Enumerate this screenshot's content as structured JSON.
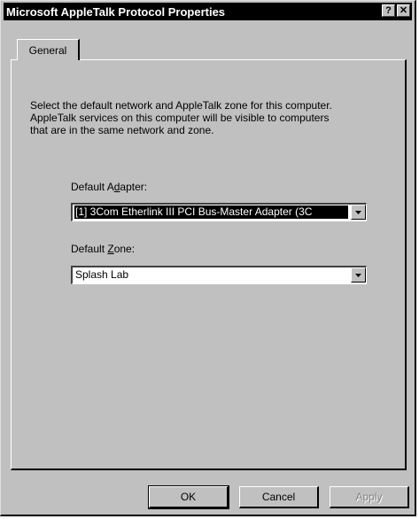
{
  "window": {
    "title": "Microsoft AppleTalk Protocol Properties",
    "help_glyph": "?",
    "close_glyph": "✕"
  },
  "tabs": [
    {
      "label": "General"
    }
  ],
  "description": {
    "line1": "Select the default network and AppleTalk zone for this computer.",
    "line2": "AppleTalk services on this computer will be visible to computers",
    "line3": "that are in the same network and zone."
  },
  "adapter": {
    "label_pre": "Default A",
    "label_ul": "d",
    "label_post": "apter:",
    "value": "[1] 3Com Etherlink III PCI Bus-Master Adapter (3C"
  },
  "zone": {
    "label_pre": "Default ",
    "label_ul": "Z",
    "label_post": "one:",
    "value": "Splash Lab"
  },
  "buttons": {
    "ok": "OK",
    "cancel": "Cancel",
    "apply": "Apply"
  },
  "colors": {
    "face": "#c0c0c0",
    "titlebar": "#000000",
    "selection": "#000000",
    "disabled_text": "#808080"
  }
}
